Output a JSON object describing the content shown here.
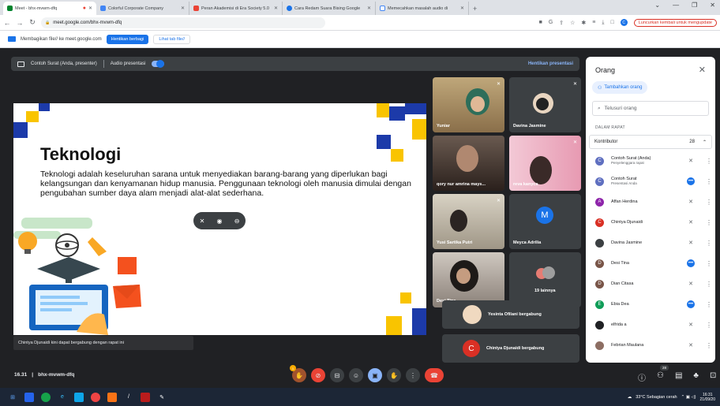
{
  "browser": {
    "tabs": [
      {
        "title": "Meet - bhx-mvwm-dfq",
        "favicon_color": "#00832d",
        "active": true
      },
      {
        "title": "Colorful Corporate Company",
        "favicon_color": "#4285f4"
      },
      {
        "title": "Peran Akademisi di Era Society 5.0",
        "favicon_color": "#ea4335"
      },
      {
        "title": "Cara Redam Suara Bising Google",
        "favicon_color": "#1a73e8"
      },
      {
        "title": "Memecahkan masalah audio di",
        "favicon_color": "#4285f4"
      }
    ],
    "new_tab": "+",
    "url": "meet.google.com/bhx-mvwm-dfq",
    "profile_initial": "C",
    "update_label": "Luncurkan kembali untuk mengupdate"
  },
  "share_bar": {
    "text": "Membagikan file// ke meet.google.com",
    "stop_label": "Hentikan berbagi",
    "hide_label": "Lihat tab file//"
  },
  "presenting_bar": {
    "presenter": "Contoh Surat (Anda, presenter)",
    "audio_label": "Audio presentasi",
    "stop_label": "Hentikan presentasi"
  },
  "slide": {
    "title": "Teknologi",
    "body": "Teknologi adalah keseluruhan sarana untuk menyediakan barang-barang yang diperlukan bagi kelangsungan dan kenyamanan hidup manusia. Penggunaan teknologi oleh manusia dimulai dengan pengubahan sumber daya alam menjadi alat-alat sederhana."
  },
  "toast": "Chintya Djunaidi kini dapat bergabung dengan rapat ini",
  "tiles": [
    {
      "name": "Yuniar",
      "muted": true
    },
    {
      "name": "Davina Jasmine",
      "muted": true
    },
    {
      "name": "qory nur amrina mays...",
      "muted": false
    },
    {
      "name": "reva kanyca",
      "muted": true
    },
    {
      "name": "Yusi Sartika Putri",
      "muted": true
    },
    {
      "name": "Meyca Adrilia",
      "initial": "M",
      "color": "#1a73e8"
    },
    {
      "name": "Desi Tina",
      "muted": false
    },
    {
      "name": "19 lainnya"
    }
  ],
  "joining": [
    {
      "text": "Yesinta Ofilani bergabung"
    },
    {
      "text": "Chintya Djunaidi bergabung",
      "initial": "C",
      "color": "#d93025"
    }
  ],
  "panel": {
    "title": "Orang",
    "add_label": "Tambahkan orang",
    "search_placeholder": "Telusuri orang",
    "section": "DALAM RAPAT",
    "group_label": "Kontributor",
    "group_count": "28",
    "people": [
      {
        "name": "Contoh Surat (Anda)",
        "sub": "Penyelenggara rapat",
        "initial": "C",
        "color": "#5f6fc0",
        "mic": "muted"
      },
      {
        "name": "Contoh Surat",
        "sub": "Presentasi Anda",
        "initial": "C",
        "color": "#5f6fc0",
        "mic": "active"
      },
      {
        "name": "Affan Herdina",
        "sub": "",
        "initial": "A",
        "color": "#8e24aa",
        "mic": "muted"
      },
      {
        "name": "Chintya Djunaidi",
        "sub": "",
        "initial": "C",
        "color": "#d93025",
        "mic": "muted"
      },
      {
        "name": "Davina Jasmine",
        "sub": "",
        "initial": "",
        "color": "#3c4043",
        "mic": "muted"
      },
      {
        "name": "Desi Tina",
        "sub": "",
        "initial": "D",
        "color": "#795548",
        "mic": "active"
      },
      {
        "name": "Dian Citasa",
        "sub": "",
        "initial": "D",
        "color": "#795548",
        "mic": "muted"
      },
      {
        "name": "Ebia Dea",
        "sub": "",
        "initial": "E",
        "color": "#0f9d58",
        "mic": "active"
      },
      {
        "name": "elfrida a",
        "sub": "",
        "initial": "",
        "color": "#202124",
        "mic": "muted"
      },
      {
        "name": "Febrian Maulana",
        "sub": "",
        "initial": "",
        "color": "#8d6e63",
        "mic": "muted"
      }
    ]
  },
  "meeting": {
    "time": "16.31",
    "code": "bhx-mvwm-dfq",
    "raise_count": "1",
    "people_count": "28"
  },
  "taskbar": {
    "weather": "33°C  Sebagian cerah",
    "time": "16:31",
    "date": "21/09/20"
  }
}
